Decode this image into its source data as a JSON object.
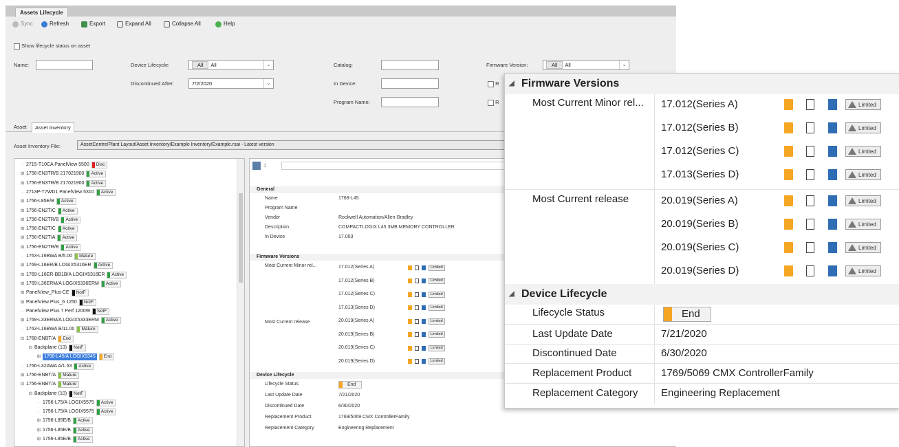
{
  "window": {
    "tab": "Assets Lifecycle"
  },
  "toolbar": [
    {
      "label": "Sync",
      "icon": "sync-icon"
    },
    {
      "label": "Refresh",
      "icon": "refresh-icon"
    },
    {
      "label": "Export",
      "icon": "export-icon"
    },
    {
      "label": "Expand All",
      "icon": "expand-all-icon"
    },
    {
      "label": "Collapse All",
      "icon": "collapse-all-icon"
    },
    {
      "label": "Help",
      "icon": "help-icon"
    }
  ],
  "filters": {
    "show_lifecycle_label": "Show lifecycle status on asset",
    "name_label": "Name:",
    "device_lifecycle_label": "Device Lifecycle:",
    "device_lifecycle_chip": "All",
    "device_lifecycle_value": "All",
    "discontinued_after_label": "Discontinued After:",
    "discontinued_after_value": "7/2/2020",
    "catalog_label": "Catalog:",
    "in_device_label": "In Device:",
    "program_name_label": "Program Name:",
    "firmware_version_label": "Firmware Version:",
    "firmware_chip": "All",
    "firmware_value": "All",
    "check_a_label": "R",
    "check_b_label": "R"
  },
  "subtabs": [
    "Asset",
    "Asset Inventory"
  ],
  "inventory_file": {
    "label": "Asset Inventory File:",
    "path": "AssetCentre/Plant Layout/Asset Inventory/Example Inventory/Example.rsai - Latest version"
  },
  "tree": [
    {
      "text": "2715-T10CA PanelView 5500",
      "status": "Disc",
      "color": "#e02020",
      "indent": 1,
      "exp": ""
    },
    {
      "text": "1756-EN3TR/B 217021900",
      "status": "Active",
      "color": "#2ea043",
      "indent": 1,
      "exp": "+"
    },
    {
      "text": "1756-EN3TR/B 217021900",
      "status": "Active",
      "color": "#2ea043",
      "indent": 1,
      "exp": "+"
    },
    {
      "text": "2713P-T7WD1 PanelView 5310",
      "status": "Active",
      "color": "#2ea043",
      "indent": 1,
      "exp": ""
    },
    {
      "text": "1756-L85E/B",
      "status": "Active",
      "color": "#2ea043",
      "indent": 1,
      "exp": "+"
    },
    {
      "text": "1756-EN2T/C",
      "status": "Active",
      "color": "#2ea043",
      "indent": 1,
      "exp": "+"
    },
    {
      "text": "1756-EN2TR/B",
      "status": "Active",
      "color": "#2ea043",
      "indent": 1,
      "exp": "+"
    },
    {
      "text": "1756-EN2T/C",
      "status": "Active",
      "color": "#2ea043",
      "indent": 1,
      "exp": "+"
    },
    {
      "text": "1756-EN2T/A",
      "status": "Active",
      "color": "#2ea043",
      "indent": 1,
      "exp": "+"
    },
    {
      "text": "1756-EN2TR/B",
      "status": "Active",
      "color": "#2ea043",
      "indent": 1,
      "exp": "+"
    },
    {
      "text": "1763-L16BWA B/5.00",
      "status": "Mature",
      "color": "#8bc34a",
      "indent": 1,
      "exp": ""
    },
    {
      "text": "1769-L16ER/B LOGIX5316ER",
      "status": "Active",
      "color": "#2ea043",
      "indent": 1,
      "exp": "+"
    },
    {
      "text": "1769-L16ER-BB1B/A LOGIX5316ER",
      "status": "Active",
      "color": "#2ea043",
      "indent": 1,
      "exp": "+"
    },
    {
      "text": "1769-L36ERM/A LOGIX5336ERM",
      "status": "Active",
      "color": "#2ea043",
      "indent": 1,
      "exp": "+"
    },
    {
      "text": "PanelView_Plus-CE",
      "status": "NotF",
      "color": "#111111",
      "indent": 1,
      "exp": "+"
    },
    {
      "text": "PanelView Plus_6 1250",
      "status": "NotF",
      "color": "#111111",
      "indent": 1,
      "exp": "+"
    },
    {
      "text": "PanelView Plus 7 Perf 1200W",
      "status": "NotF",
      "color": "#111111",
      "indent": 1,
      "exp": ""
    },
    {
      "text": "1769-L33ERM/A LOGIX5333ERM",
      "status": "Active",
      "color": "#2ea043",
      "indent": 1,
      "exp": "+"
    },
    {
      "text": "1763-L16BWA B/11.00",
      "status": "Mature",
      "color": "#8bc34a",
      "indent": 1,
      "exp": ""
    },
    {
      "text": "1768-ENBT/A",
      "status": "End",
      "color": "#f5a623",
      "indent": 1,
      "exp": "−"
    },
    {
      "text": "Backplane (13)",
      "status": "NotF",
      "color": "#111111",
      "indent": 2,
      "exp": "−"
    },
    {
      "text": "1768-L45/A LOGIX5345",
      "status": "End",
      "color": "#f5a623",
      "indent": 3,
      "exp": "+",
      "selected": true
    },
    {
      "text": "1766-L32AWA A/1.63",
      "status": "Active",
      "color": "#2ea043",
      "indent": 1,
      "exp": ""
    },
    {
      "text": "1756-ENBT/A",
      "status": "Mature",
      "color": "#8bc34a",
      "indent": 1,
      "exp": "+"
    },
    {
      "text": "1756-ENBT/A",
      "status": "Mature",
      "color": "#8bc34a",
      "indent": 1,
      "exp": "−"
    },
    {
      "text": "Backplane (10)",
      "status": "NotF",
      "color": "#111111",
      "indent": 2,
      "exp": "−"
    },
    {
      "text": "1756-L75/A LOGIX5575",
      "status": "Active",
      "color": "#2ea043",
      "indent": 3,
      "exp": ""
    },
    {
      "text": "1756-L75/A LOGIX5575",
      "status": "Active",
      "color": "#2ea043",
      "indent": 3,
      "exp": ""
    },
    {
      "text": "1756-L85E/B",
      "status": "Active",
      "color": "#2ea043",
      "indent": 3,
      "exp": "+"
    },
    {
      "text": "1756-L85E/B",
      "status": "Active",
      "color": "#2ea043",
      "indent": 3,
      "exp": "+"
    },
    {
      "text": "1756-L85E/B",
      "status": "Active",
      "color": "#2ea043",
      "indent": 3,
      "exp": "+"
    }
  ],
  "props": {
    "general_title": "General",
    "general": [
      {
        "label": "Name",
        "value": "1768-L45"
      },
      {
        "label": "Program Name",
        "value": ""
      },
      {
        "label": "Vendor",
        "value": "Rockwell Automation/Allen-Bradley"
      },
      {
        "label": "Description",
        "value": "COMPACTLOGIX L45 3MB MEMORY CONTROLLER"
      },
      {
        "label": "In Device",
        "value": "17.003"
      }
    ],
    "firmware_title": "Firmware Versions",
    "fw_minor_label": "Most Current Minor rel...",
    "fw_release_label": "Most Current release",
    "device_title": "Device Lifecycle",
    "device": [
      {
        "label": "Lifecycle Status",
        "value": "End"
      },
      {
        "label": "Last Update Date",
        "value": "7/21/2020"
      },
      {
        "label": "Discontinued Date",
        "value": "6/30/2020"
      },
      {
        "label": "Replacement Product",
        "value": "1769/5069 CMX ControllerFamily"
      },
      {
        "label": "Replacement Category",
        "value": "Engineering Replacement"
      }
    ]
  },
  "firmware": {
    "minor_label": "Most Current Minor rel...",
    "minor": [
      "17.012(Series A)",
      "17.012(Series B)",
      "17.012(Series C)",
      "17.013(Series D)"
    ],
    "release_label": "Most Current release",
    "release": [
      "20.019(Series A)",
      "20.019(Series B)",
      "20.019(Series C)",
      "20.019(Series D)"
    ],
    "limited_label": "Limited"
  },
  "overlay": {
    "firmware_title": "Firmware Versions",
    "device_title": "Device Lifecycle",
    "lifecycle_status_label": "Lifecycle Status",
    "lifecycle_status_value": "End",
    "last_update_label": "Last Update Date",
    "last_update_value": "7/21/2020",
    "discontinued_label": "Discontinued Date",
    "discontinued_value": "6/30/2020",
    "replacement_product_label": "Replacement Product",
    "replacement_product_value": "1769/5069 CMX ControllerFamily",
    "replacement_category_label": "Replacement Category",
    "replacement_category_value": "Engineering Replacement"
  },
  "colors": {
    "end": "#f5a623",
    "active": "#2ea043",
    "mature": "#8bc34a",
    "disc": "#e02020",
    "selected": "#3b7ddd"
  }
}
